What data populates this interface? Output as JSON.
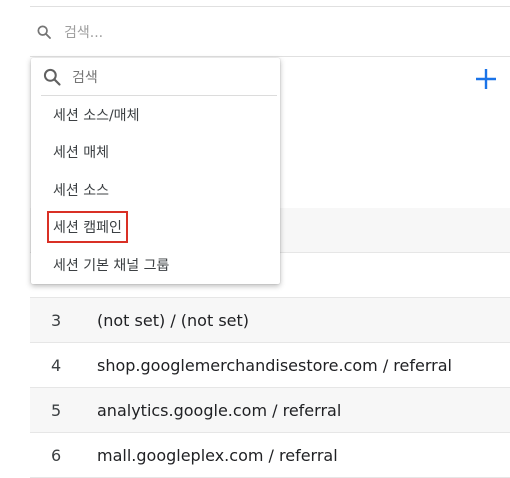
{
  "search": {
    "placeholder": "검색..."
  },
  "dropdown": {
    "search_placeholder": "검색",
    "items": [
      {
        "label": "세션 소스/매체"
      },
      {
        "label": "세션 매체"
      },
      {
        "label": "세션 소스"
      },
      {
        "label": "세션 캠페인",
        "highlighted": true
      },
      {
        "label": "세션 기본 채널 그룹"
      }
    ]
  },
  "table": {
    "rows": [
      {
        "index": "",
        "value": ""
      },
      {
        "index": "",
        "value": ""
      },
      {
        "index": "3",
        "value": "(not set) / (not set)"
      },
      {
        "index": "4",
        "value": "shop.googlemerchandisestore.com / referral"
      },
      {
        "index": "5",
        "value": "analytics.google.com / referral"
      },
      {
        "index": "6",
        "value": "mall.googleplex.com / referral"
      }
    ]
  },
  "colors": {
    "accent": "#1a73e8",
    "highlight_border": "#d93025"
  }
}
